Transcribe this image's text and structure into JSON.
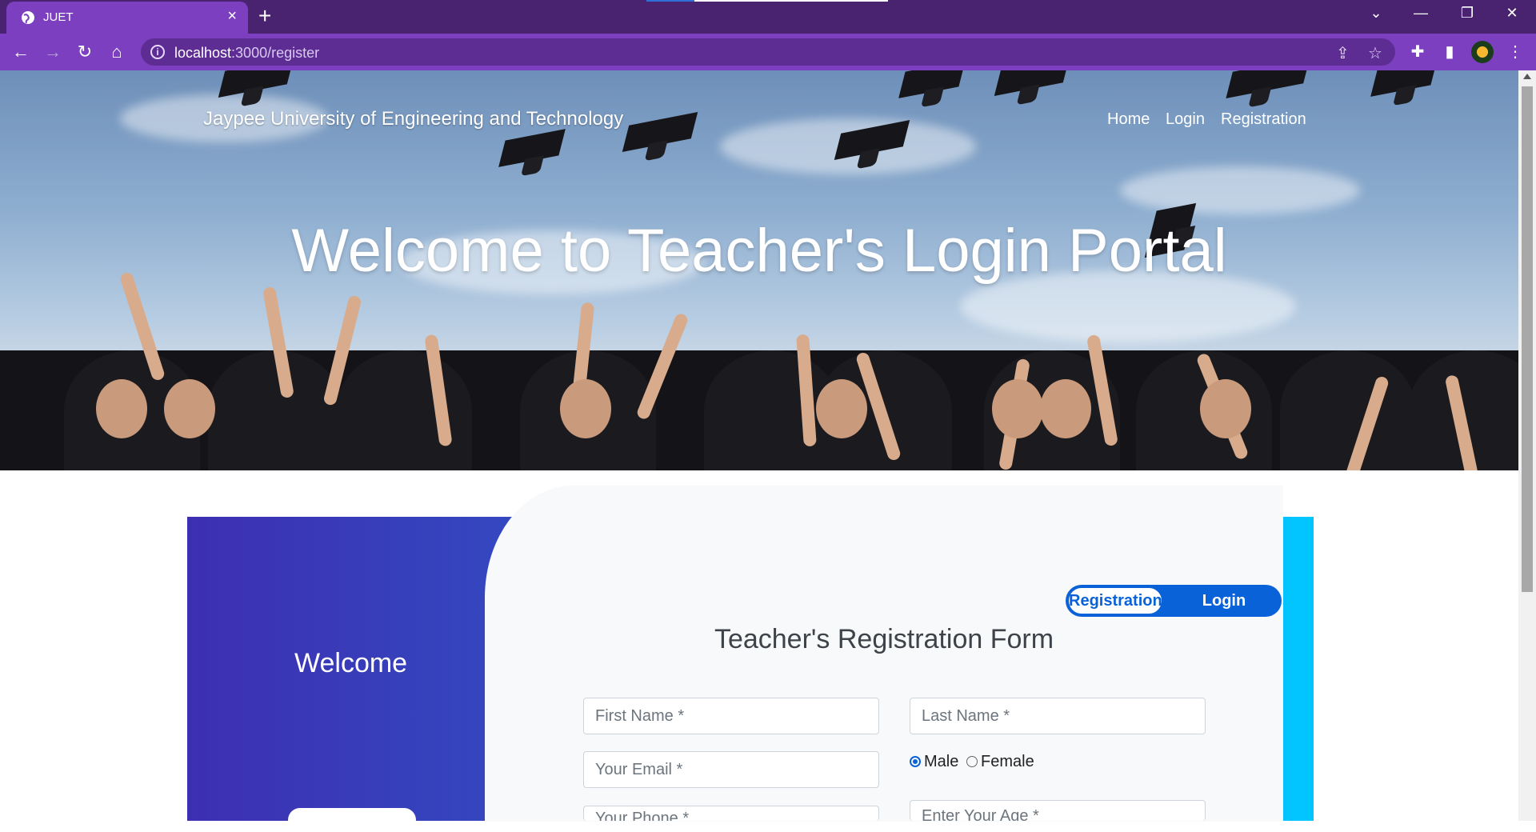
{
  "browser": {
    "tab_title": "JUET",
    "url_host": "localhost",
    "url_path": ":3000/register",
    "new_tab": "+",
    "close": "×"
  },
  "site": {
    "brand": "Jaypee University of Engineering and Technology",
    "nav": [
      "Home",
      "Login",
      "Registration"
    ],
    "hero_title": "Welcome to Teacher's Login Portal"
  },
  "form": {
    "side_welcome": "Welcome",
    "switch_active": "Registration",
    "switch_inactive": "Login",
    "title": "Teacher's Registration Form",
    "first_name": "First Name *",
    "last_name": "Last Name *",
    "email": "Your Email *",
    "gender_options": [
      "Male",
      "Female"
    ],
    "gender_selected": "Male",
    "phone": "Your Phone *",
    "age": "Enter Your Age *"
  }
}
